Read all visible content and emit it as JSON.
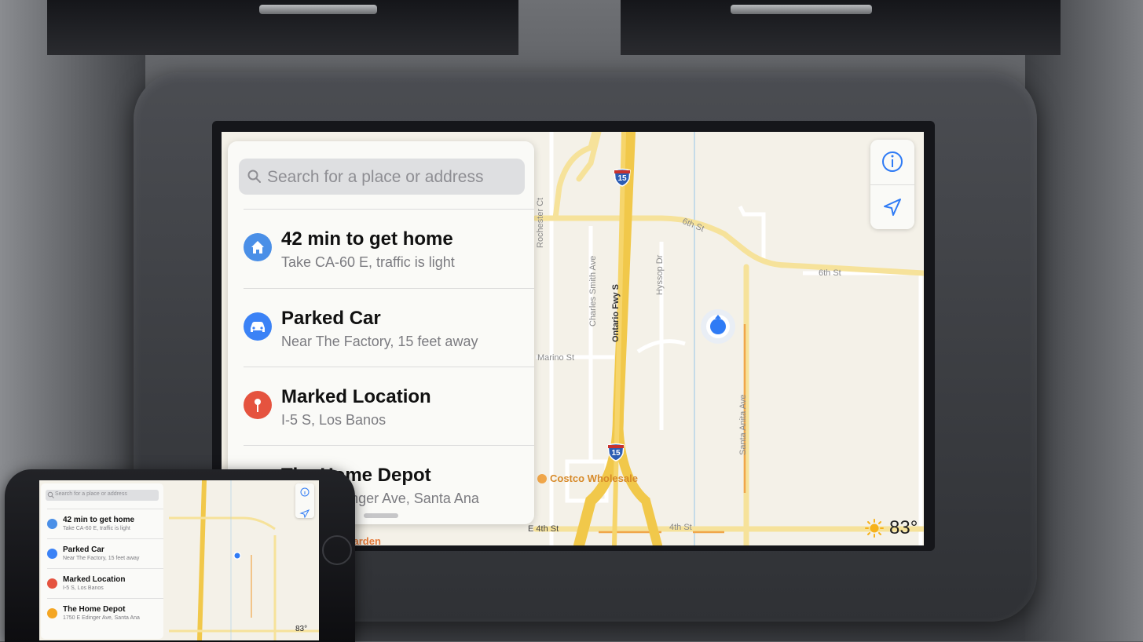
{
  "search": {
    "placeholder": "Search for a place or address"
  },
  "suggestions": [
    {
      "title": "42 min to get home",
      "subtitle": "Take CA-60 E, traffic is light",
      "icon": "home-icon",
      "color": "#4a8fe7"
    },
    {
      "title": "Parked Car",
      "subtitle": "Near The Factory, 15 feet away",
      "icon": "car-icon",
      "color": "#3b82f6"
    },
    {
      "title": "Marked Location",
      "subtitle": "I-5 S, Los Banos",
      "icon": "pin-icon",
      "color": "#e5533f"
    },
    {
      "title": "The Home Depot",
      "subtitle": "1750 E Edinger Ave, Santa Ana",
      "icon": "store-icon",
      "color": "#f4a623"
    }
  ],
  "map": {
    "roads": {
      "sixth_st_a": "6th St",
      "sixth_st_b": "6th St",
      "fourth_st": "4th St",
      "e_fourth_st": "E 4th St",
      "marino_st": "Marino St",
      "rochester": "Rochester Ct",
      "charles_smith": "Charles Smith Ave",
      "ontario_fwy": "Ontario Fwy S",
      "hyssop": "Hyssop Dr",
      "santa_anita": "Santa Anita Ave"
    },
    "shield_number": "15",
    "poi": {
      "costco": "Costco Wholesale",
      "olive_garden": "Olive Garden"
    }
  },
  "controls": {
    "info": "info-icon",
    "locate": "location-arrow-icon"
  },
  "weather": {
    "temp": "83°",
    "icon": "sun-icon"
  },
  "colors": {
    "accent": "#2f7bf5",
    "highway": "#f3c73a",
    "road": "#f6e29a",
    "map_bg": "#f4f1e8"
  }
}
